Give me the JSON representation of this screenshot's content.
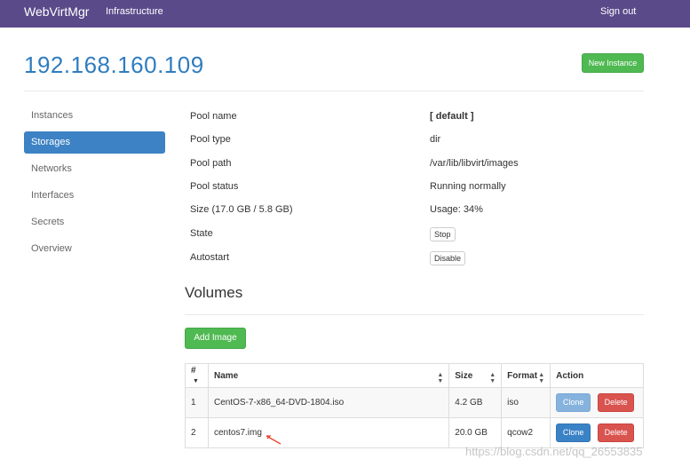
{
  "navbar": {
    "brand": "WebVirtMgr",
    "infrastructure": "Infrastructure",
    "sign_out": "Sign out",
    "color": "#5b4a8a"
  },
  "page": {
    "host": "192.168.160.109",
    "new_instance_label": "New Instance"
  },
  "sidebar": {
    "items": [
      {
        "label": "Instances",
        "active": false
      },
      {
        "label": "Storages",
        "active": true
      },
      {
        "label": "Networks",
        "active": false
      },
      {
        "label": "Interfaces",
        "active": false
      },
      {
        "label": "Secrets",
        "active": false
      },
      {
        "label": "Overview",
        "active": false
      }
    ]
  },
  "pool": {
    "name_label": "Pool name",
    "name_value": "[ default ]",
    "type_label": "Pool type",
    "type_value": "dir",
    "path_label": "Pool path",
    "path_value": "/var/lib/libvirt/images",
    "status_label": "Pool status",
    "status_value": "Running normally",
    "size_label": "Size (17.0 GB / 5.8 GB)",
    "usage_value": "Usage: 34%",
    "state_label": "State",
    "stop_label": "Stop",
    "autostart_label": "Autostart",
    "disable_label": "Disable"
  },
  "volumes": {
    "title": "Volumes",
    "add_image_label": "Add Image",
    "columns": [
      "#",
      "Name",
      "Size",
      "Format",
      "Action"
    ],
    "rows": [
      {
        "num": "1",
        "name": "CentOS-7-x86_64-DVD-1804.iso",
        "size": "4.2 GB",
        "format": "iso",
        "clone": "Clone",
        "delete": "Delete"
      },
      {
        "num": "2",
        "name": "centos7.img",
        "size": "20.0 GB",
        "format": "qcow2",
        "clone": "Clone",
        "delete": "Delete"
      }
    ]
  },
  "watermark": "https://blog.csdn.net/qq_26553835"
}
